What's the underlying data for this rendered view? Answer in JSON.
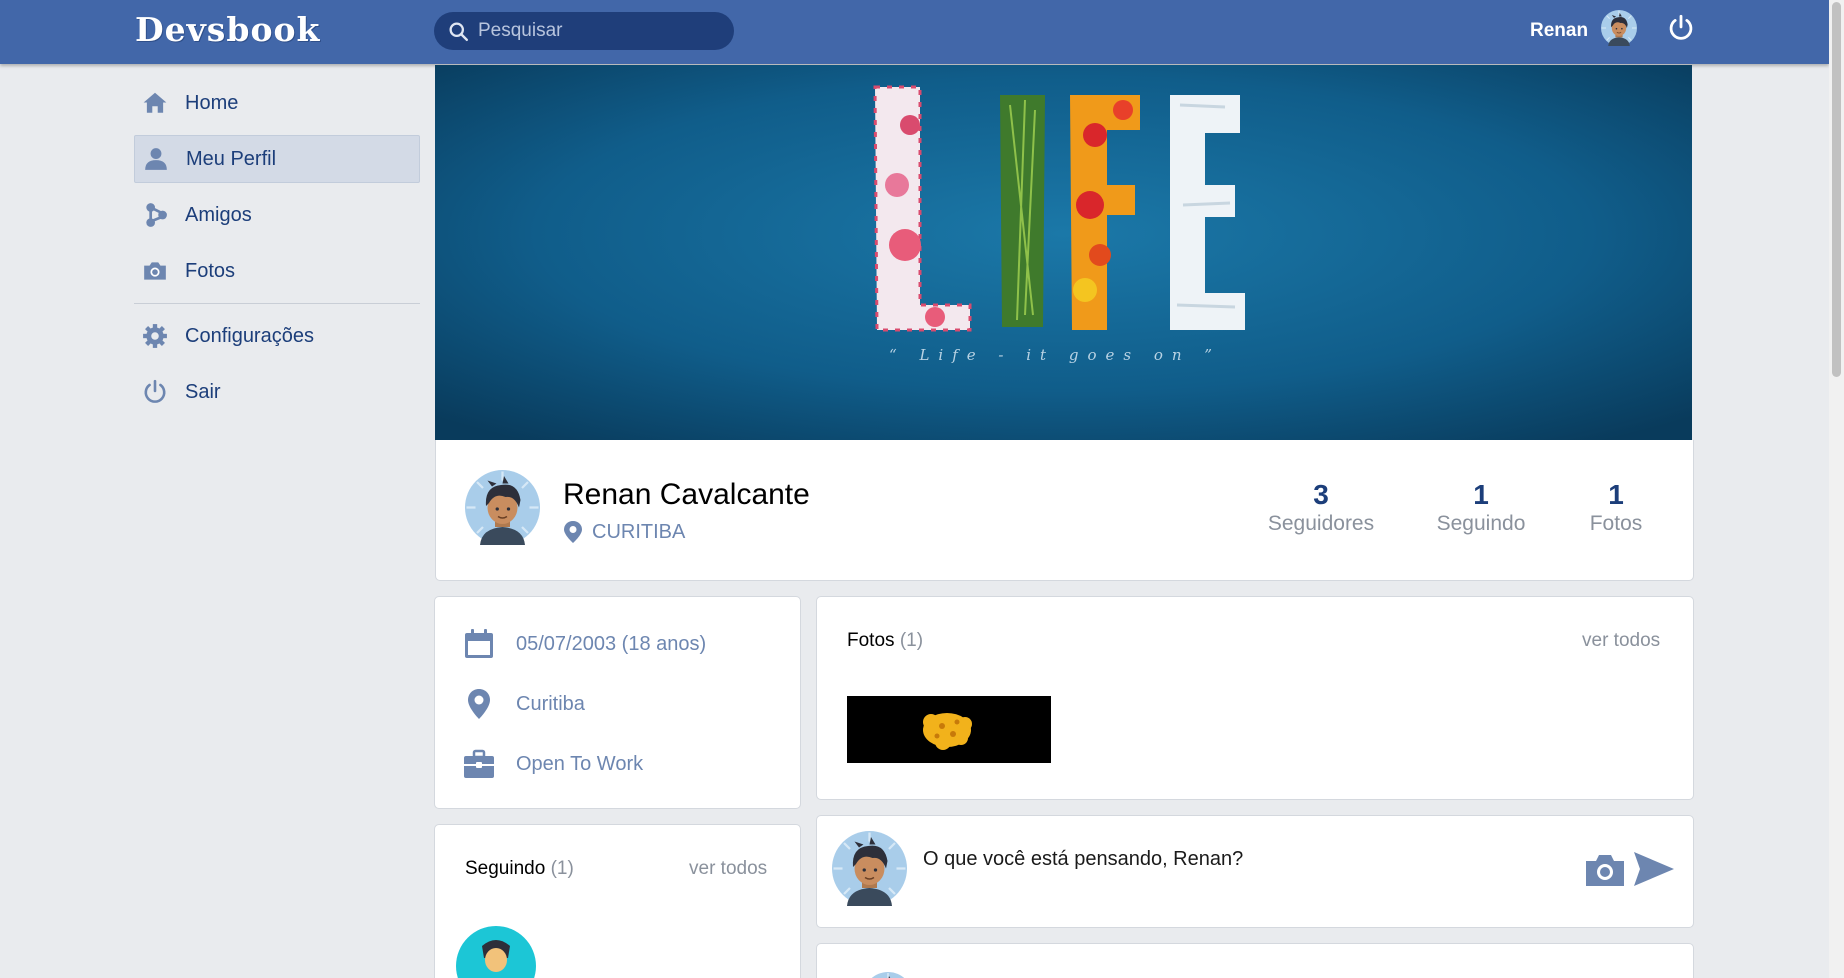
{
  "app": {
    "logo": "Devsbook"
  },
  "header": {
    "search_placeholder": "Pesquisar",
    "user_name": "Renan"
  },
  "sidebar": {
    "items": [
      {
        "label": "Home",
        "icon": "home-icon"
      },
      {
        "label": "Meu Perfil",
        "icon": "user-icon",
        "active": true
      },
      {
        "label": "Amigos",
        "icon": "friends-icon"
      },
      {
        "label": "Fotos",
        "icon": "camera-icon"
      }
    ],
    "bottom_items": [
      {
        "label": "Configurações",
        "icon": "gear-icon"
      },
      {
        "label": "Sair",
        "icon": "power-icon"
      }
    ]
  },
  "cover": {
    "word": "LIFE",
    "caption": "“ Life - it goes on ”"
  },
  "profile": {
    "name": "Renan Cavalcante",
    "location": "CURITIBA",
    "stats": [
      {
        "value": "3",
        "label": "Seguidores"
      },
      {
        "value": "1",
        "label": "Seguindo"
      },
      {
        "value": "1",
        "label": "Fotos"
      }
    ]
  },
  "info": {
    "birthdate": "05/07/2003 (18 anos)",
    "city": "Curitiba",
    "work": "Open To Work"
  },
  "photos_card": {
    "title": "Fotos",
    "count": "(1)",
    "see_all": "ver todos"
  },
  "following_card": {
    "title": "Seguindo",
    "count": "(1)",
    "see_all": "ver todos"
  },
  "composer": {
    "placeholder": "O que você está pensando, Renan?"
  },
  "colors": {
    "header": "#4267a9",
    "accent": "#1c3e7a",
    "muted_link": "#6d86b0",
    "background": "#e9ebee"
  }
}
